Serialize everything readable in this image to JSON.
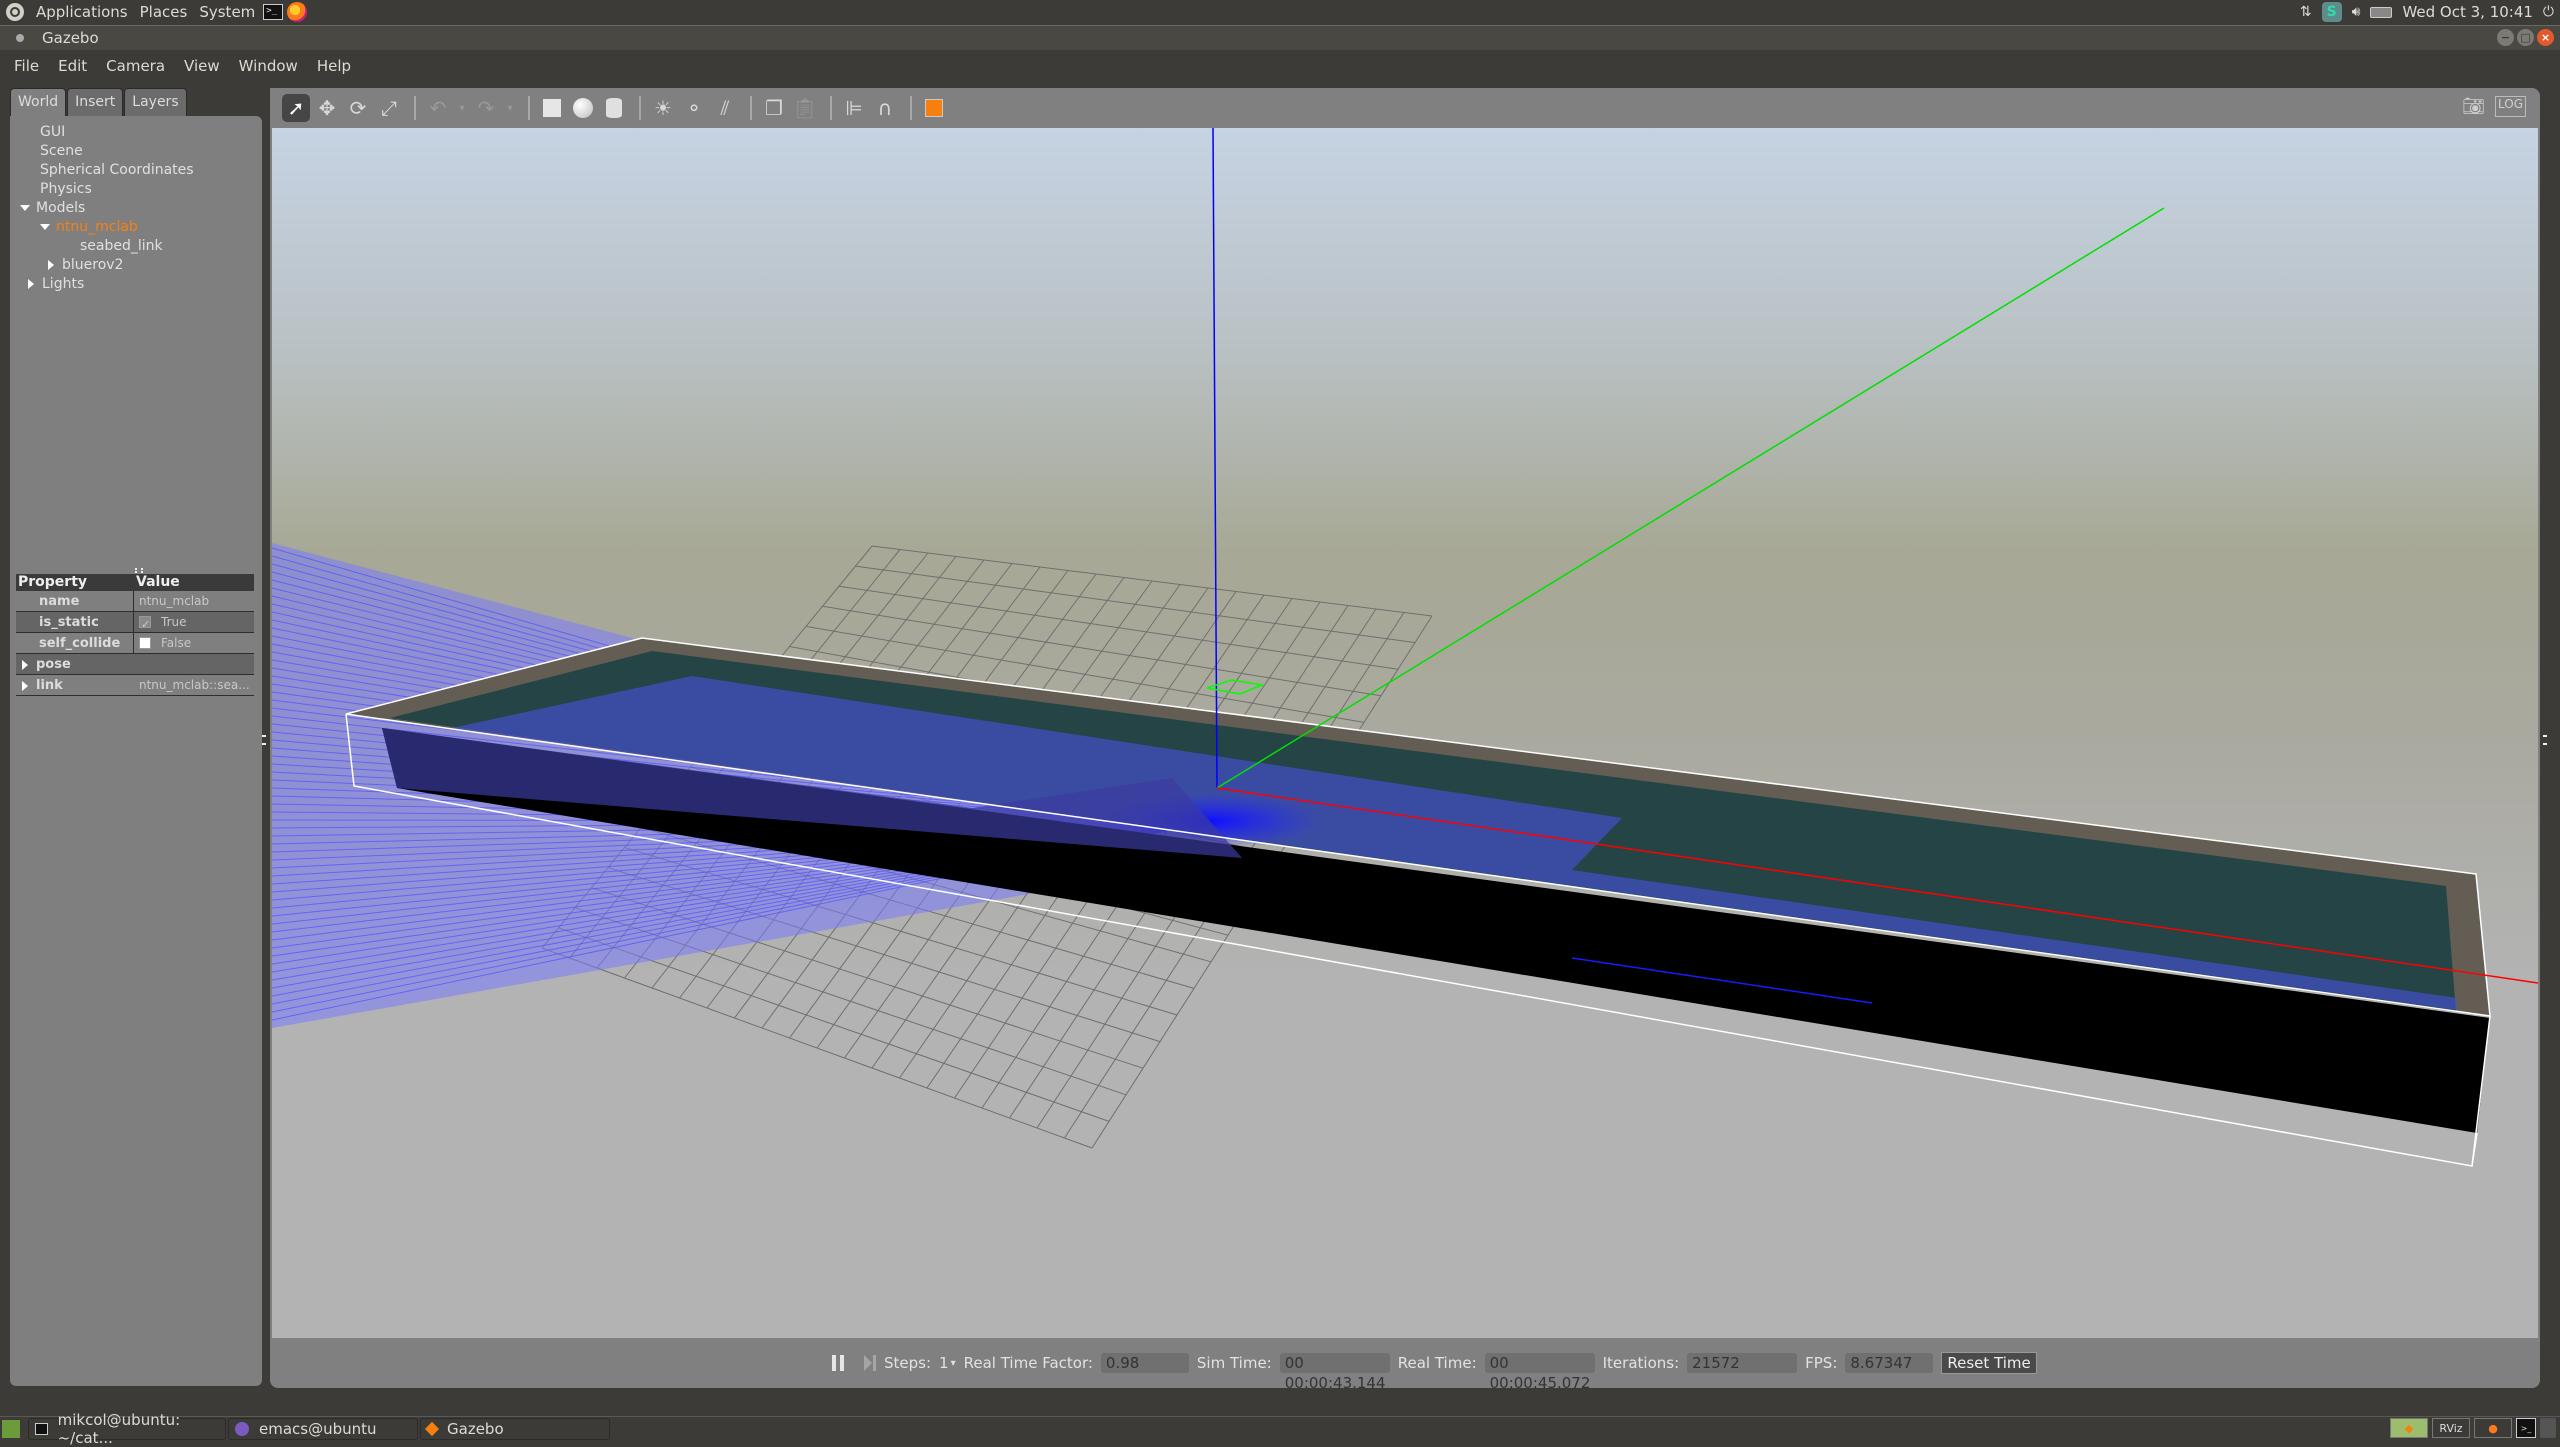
{
  "system_panel": {
    "menus": [
      "Applications",
      "Places",
      "System"
    ],
    "clock": "Wed Oct 3, 10:41"
  },
  "window": {
    "title": "Gazebo"
  },
  "menubar": {
    "items": [
      "File",
      "Edit",
      "Camera",
      "View",
      "Window",
      "Help"
    ]
  },
  "left_panel": {
    "tabs": [
      "World",
      "Insert",
      "Layers"
    ],
    "active_tab": "World",
    "tree": {
      "gui": "GUI",
      "scene": "Scene",
      "spherical": "Spherical Coordinates",
      "physics": "Physics",
      "models": "Models",
      "model_selected": "ntnu_mclab",
      "link": "seabed_link",
      "bluerov": "bluerov2",
      "lights": "Lights"
    },
    "properties": {
      "header_property": "Property",
      "header_value": "Value",
      "rows": [
        {
          "key": "name",
          "value": "ntnu_mclab"
        },
        {
          "key": "is_static",
          "value": "True",
          "checked": true
        },
        {
          "key": "self_collide",
          "value": "False",
          "checked": false
        },
        {
          "key": "pose",
          "value": ""
        },
        {
          "key": "link",
          "value": "ntnu_mclab::sea..."
        }
      ]
    }
  },
  "toolbar": {
    "tools": [
      "select",
      "translate",
      "rotate",
      "scale",
      "undo",
      "redo",
      "box",
      "sphere",
      "cylinder",
      "point-light",
      "spot-light",
      "directional-light",
      "copy",
      "paste",
      "align",
      "snap",
      "view-angle"
    ],
    "right": [
      "screenshot",
      "log"
    ]
  },
  "scene": {
    "colors": {
      "sky_top": "#b9c9dc",
      "sky_mid": "#a3a38f",
      "ground": "#b3b3b3",
      "pool_rim": "#635d53",
      "water": "#244446",
      "laser": "#4a4aff",
      "axis_x": "#ff0000",
      "axis_y": "#00ff00",
      "axis_z": "#0000ff"
    }
  },
  "bottom_bar": {
    "steps_label": "Steps:",
    "steps_value": "1",
    "rtf_label": "Real Time Factor:",
    "rtf_value": "0.98",
    "sim_time_label": "Sim Time:",
    "sim_time_value": "00 00:00:43.144",
    "real_time_label": "Real Time:",
    "real_time_value": "00 00:00:45.072",
    "iterations_label": "Iterations:",
    "iterations_value": "21572",
    "fps_label": "FPS:",
    "fps_value": "8.67347",
    "reset_label": "Reset Time"
  },
  "taskbar": {
    "tasks": [
      "mikcol@ubuntu: ~/cat...",
      "emacs@ubuntu",
      "Gazebo"
    ],
    "tray_apps": [
      "gazebo",
      "RViz",
      "firefox",
      "terminal",
      "trash"
    ]
  }
}
